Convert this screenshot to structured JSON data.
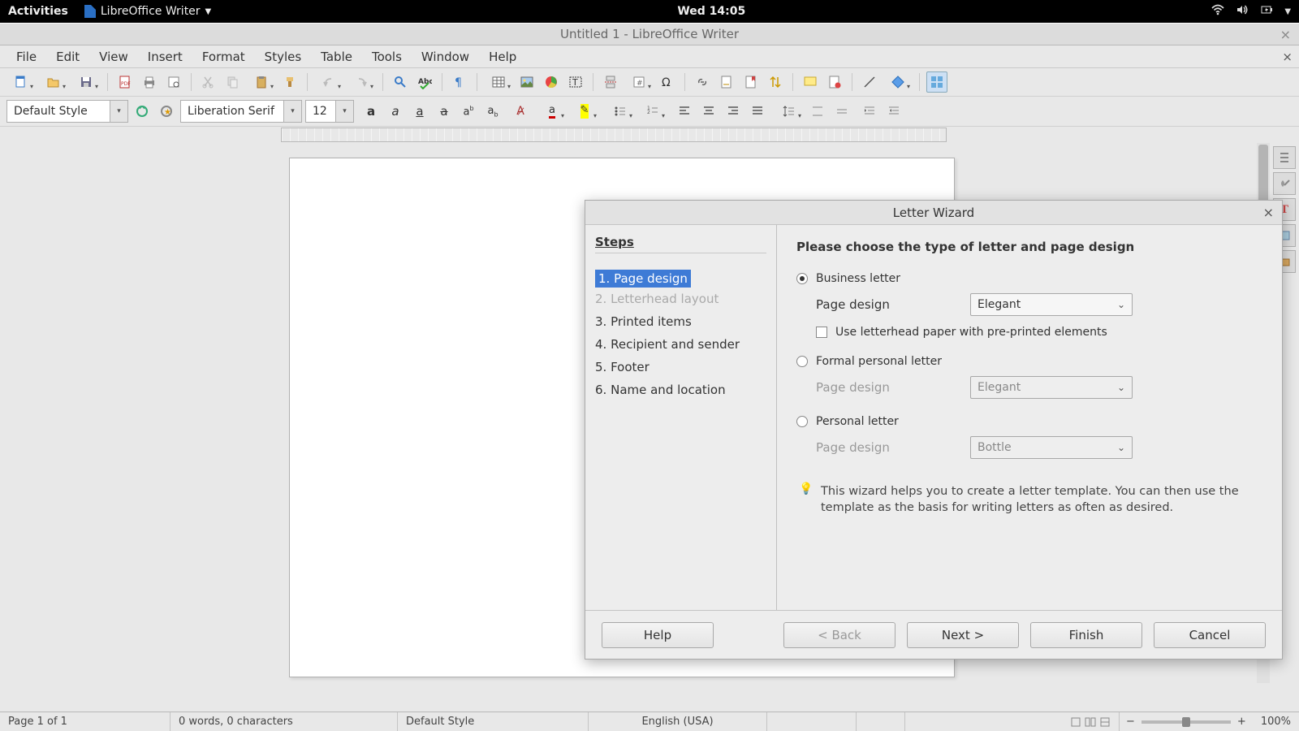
{
  "gnome": {
    "activities": "Activities",
    "app": "LibreOffice Writer",
    "clock": "Wed 14:05"
  },
  "window": {
    "title": "Untitled 1 - LibreOffice Writer"
  },
  "menus": [
    "File",
    "Edit",
    "View",
    "Insert",
    "Format",
    "Styles",
    "Table",
    "Tools",
    "Window",
    "Help"
  ],
  "format": {
    "style": "Default Style",
    "font": "Liberation Serif",
    "size": "12"
  },
  "status": {
    "page": "Page 1 of 1",
    "words": "0 words, 0 characters",
    "style": "Default Style",
    "lang": "English (USA)",
    "zoom": "100%"
  },
  "wizard": {
    "title": "Letter Wizard",
    "steps_heading": "Steps",
    "steps": [
      {
        "n": "1.",
        "label": "Page design",
        "state": "current"
      },
      {
        "n": "2.",
        "label": "Letterhead layout",
        "state": "disabled"
      },
      {
        "n": "3.",
        "label": "Printed items",
        "state": "normal"
      },
      {
        "n": "4.",
        "label": "Recipient and sender",
        "state": "normal"
      },
      {
        "n": "5.",
        "label": "Footer",
        "state": "normal"
      },
      {
        "n": "6.",
        "label": "Name and location",
        "state": "normal"
      }
    ],
    "heading": "Please choose the type of letter and page design",
    "opts": {
      "business": "Business letter",
      "formal": "Formal personal letter",
      "personal": "Personal letter",
      "page_design": "Page design",
      "letterhead_cb": "Use letterhead paper with pre-printed elements",
      "sel_business": "Elegant",
      "sel_formal": "Elegant",
      "sel_personal": "Bottle"
    },
    "hint": "This wizard helps you to create a letter template. You can then use the template as the basis for writing letters as often as desired.",
    "buttons": {
      "help": "Help",
      "back": "< Back",
      "next": "Next >",
      "finish": "Finish",
      "cancel": "Cancel"
    }
  }
}
